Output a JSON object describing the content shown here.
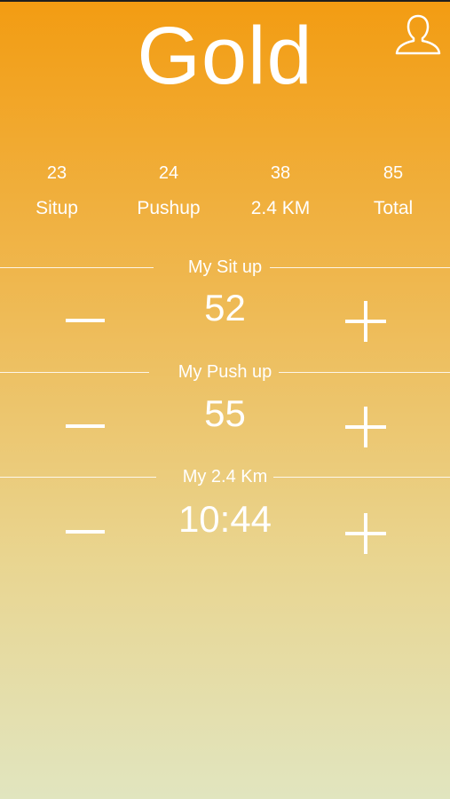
{
  "header": {
    "title": "Gold",
    "profile_icon": "user-silhouette-icon"
  },
  "stats": [
    {
      "value": "23",
      "label": "Situp"
    },
    {
      "value": "24",
      "label": "Pushup"
    },
    {
      "value": "38",
      "label": "2.4 KM"
    },
    {
      "value": "85",
      "label": "Total"
    }
  ],
  "sections": {
    "situp": {
      "title": "My Sit up",
      "value": "52"
    },
    "pushup": {
      "title": "My Push up",
      "value": "55"
    },
    "run": {
      "title": "My 2.4 Km",
      "value": "10:44"
    }
  },
  "controls": {
    "minus_icon": "minus-icon",
    "plus_icon": "plus-icon"
  },
  "colors": {
    "gradient_top": "#f39c12",
    "gradient_bottom": "#e1e5bf",
    "text": "#ffffff"
  }
}
